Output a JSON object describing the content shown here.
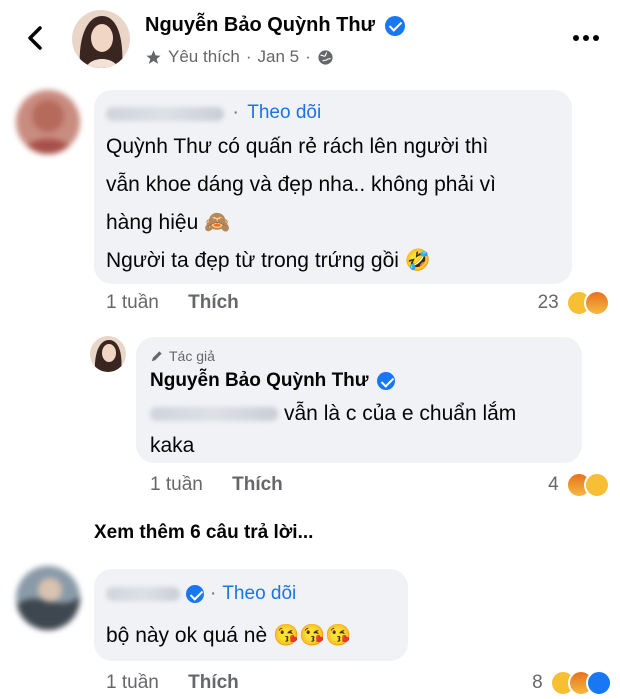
{
  "header": {
    "author": "Nguyễn Bảo Quỳnh Thư",
    "liked_label": "Yêu thích",
    "separator": "·",
    "date": "Jan 5",
    "separator2": "·"
  },
  "comments": [
    {
      "follow_label": "Theo dõi",
      "lines": [
        "Quỳnh Thư có quấn rẻ rách lên người thì",
        "vẫn khoe dáng và đẹp nha.. không phải vì",
        "hàng hiệu 🙈",
        "Người ta đẹp từ trong trứng gồi 🤣"
      ],
      "time": "1 tuần",
      "like_label": "Thích",
      "reaction_count": "23",
      "reactions": [
        "haha",
        "angry"
      ]
    },
    {
      "author_badge": "Tác giả",
      "author": "Nguyễn Bảo Quỳnh Thư",
      "lines": [
        "vẫn là c của e chuẩn lắm",
        "kaka"
      ],
      "time": "1 tuần",
      "like_label": "Thích",
      "reaction_count": "4",
      "reactions": [
        "angry",
        "haha"
      ]
    },
    {
      "follow_label": "Theo dõi",
      "text": "bộ này ok quá nè 😘😘😘",
      "time": "1 tuần",
      "like_label": "Thích",
      "reaction_count": "8",
      "reactions": [
        "haha",
        "angry",
        "like"
      ]
    }
  ],
  "more_replies": "Xem thêm 6 câu trả lời...",
  "icons": [
    "back-arrow-icon",
    "star-icon",
    "globe-icon",
    "more-icon",
    "verified-icon",
    "pencil-icon",
    "see-no-evil-emoji",
    "rofl-emoji",
    "kiss-emoji",
    "haha-reaction-icon",
    "angry-reaction-icon",
    "like-reaction-icon"
  ],
  "colors": {
    "link": "#1b74e4",
    "verified": "#1877f2",
    "bubble": "#f0f2f5",
    "muted": "#65676b"
  }
}
